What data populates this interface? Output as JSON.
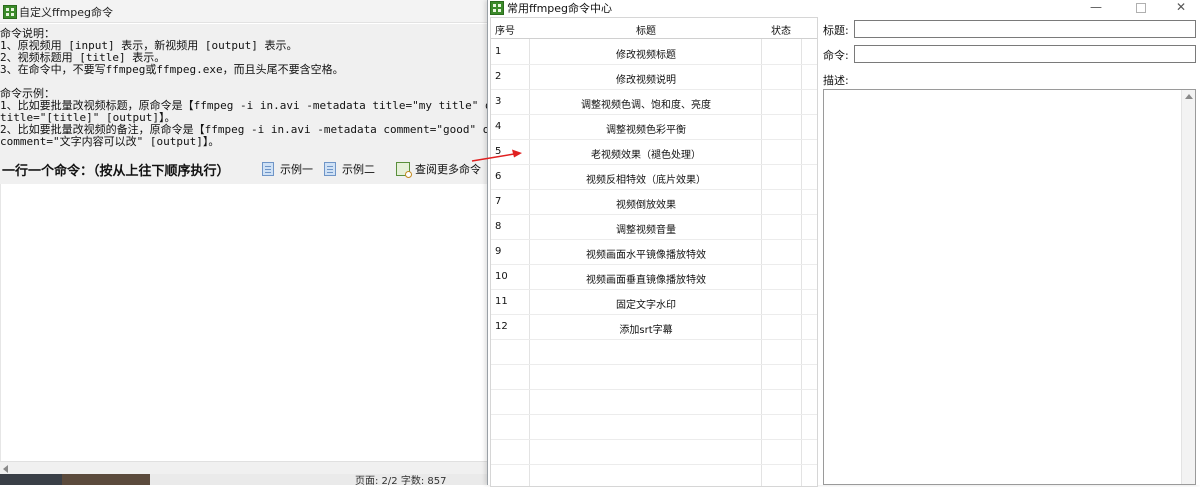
{
  "left_window": {
    "title": "自定义ffmpeg命令",
    "instructions": [
      "命令说明：",
      "1、原视频用 [input] 表示，新视频用 [output] 表示。",
      "2、视频标题用 [title] 表示。",
      "3、在命令中，不要写ffmpeg或ffmpeg.exe，而且头尾不要含空格。",
      "",
      "命令示例：",
      "1、比如要批量改视频标题，原命令是【ffmpeg -i in.avi -metadata title=\"my title\" out.flv】",
      "title=\"[title]\" [output]】。",
      "2、比如要批量改视频的备注，原命令是【ffmpeg -i in.avi -metadata comment=\"good\" out.flv】",
      "comment=\"文字内容可以改\" [output]】。"
    ],
    "command_heading": "一行一个命令：（按从上往下顺序执行）",
    "links": {
      "example1": "示例一",
      "example2": "示例二",
      "more": "查阅更多命令"
    },
    "status": "页面: 2/2   字数: 857"
  },
  "right_window": {
    "title": "常用ffmpeg命令中心",
    "controls": {
      "minimize": "—",
      "close": "✕"
    },
    "table": {
      "headers": {
        "num": "序号",
        "title": "标题",
        "status": "状态"
      },
      "rows": [
        {
          "num": "1",
          "title": "修改视频标题",
          "status": ""
        },
        {
          "num": "2",
          "title": "修改视频说明",
          "status": ""
        },
        {
          "num": "3",
          "title": "调整视频色调、饱和度、亮度",
          "status": ""
        },
        {
          "num": "4",
          "title": "调整视频色彩平衡",
          "status": ""
        },
        {
          "num": "5",
          "title": "老视频效果（褪色处理）",
          "status": ""
        },
        {
          "num": "6",
          "title": "视频反相特效（底片效果）",
          "status": ""
        },
        {
          "num": "7",
          "title": "视频倒放效果",
          "status": ""
        },
        {
          "num": "8",
          "title": "调整视频音量",
          "status": ""
        },
        {
          "num": "9",
          "title": "视频画面水平镜像播放特效",
          "status": ""
        },
        {
          "num": "10",
          "title": "视频画面垂直镜像播放特效",
          "status": ""
        },
        {
          "num": "11",
          "title": "固定文字水印",
          "status": ""
        },
        {
          "num": "12",
          "title": "添加srt字幕",
          "status": ""
        }
      ]
    },
    "details": {
      "title_label": "标题:",
      "title_value": "",
      "command_label": "命令:",
      "command_value": "",
      "description_label": "描述:",
      "description_value": ""
    }
  },
  "colors": {
    "arrow": "#e02020",
    "app_icon": "#3b8a2a"
  }
}
